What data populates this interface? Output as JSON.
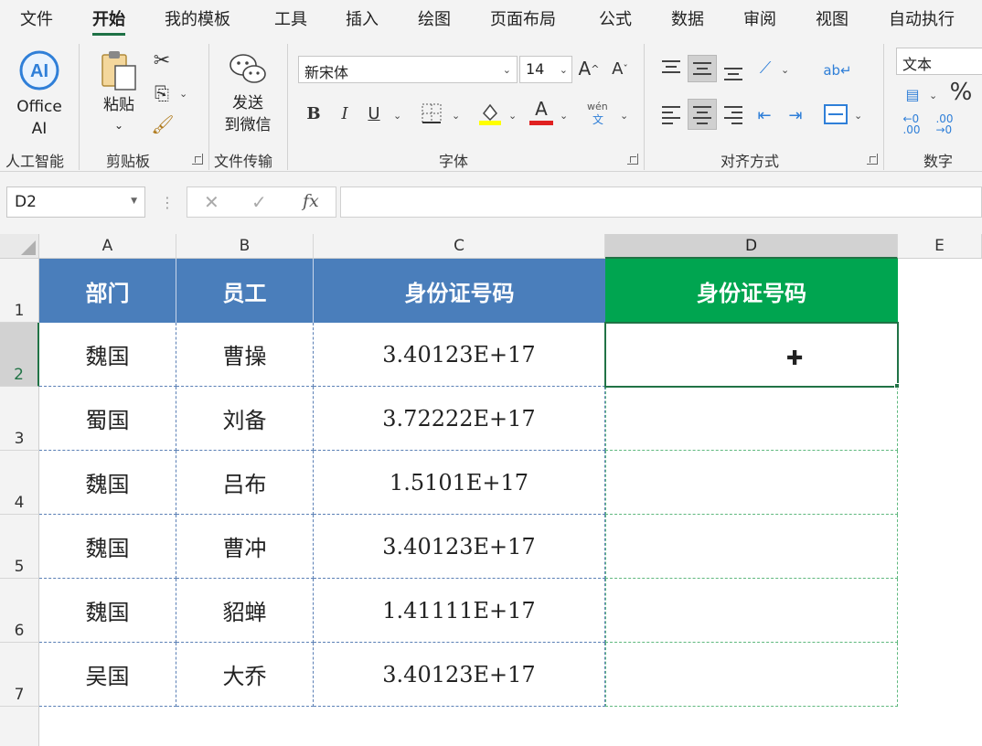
{
  "menu": {
    "tabs": [
      "文件",
      "开始",
      "我的模板",
      "工具",
      "插入",
      "绘图",
      "页面布局",
      "公式",
      "数据",
      "审阅",
      "视图",
      "自动执行"
    ],
    "active": "开始"
  },
  "ribbon": {
    "ai_group": {
      "button_line1": "Office",
      "button_line2": "AI",
      "label": "人工智能"
    },
    "clipboard": {
      "paste_label": "粘贴",
      "label": "剪贴板"
    },
    "transfer": {
      "button_line1": "发送",
      "button_line2": "到微信",
      "label": "文件传输"
    },
    "font": {
      "font_name": "新宋体",
      "font_size": "14",
      "label": "字体",
      "bold": "B",
      "italic": "I",
      "underline": "U",
      "grow": "A",
      "shrink": "A",
      "font_color_letter": "A",
      "phonetic_top": "wén",
      "phonetic_bottom": "文"
    },
    "align": {
      "label": "对齐方式"
    },
    "number": {
      "format": "文本",
      "label": "数字",
      "percent": "%"
    }
  },
  "formula_bar": {
    "name_box": "D2",
    "fx": "fx",
    "formula": ""
  },
  "sheet": {
    "columns": [
      "A",
      "B",
      "C",
      "D",
      "E"
    ],
    "rows": [
      "1",
      "2",
      "3",
      "4",
      "5",
      "6",
      "7"
    ],
    "header": [
      "部门",
      "员工",
      "身份证号码",
      "身份证号码"
    ],
    "data": [
      [
        "魏国",
        "曹操",
        "3.40123E+17",
        ""
      ],
      [
        "蜀国",
        "刘备",
        "3.72222E+17",
        ""
      ],
      [
        "魏国",
        "吕布",
        "1.5101E+17",
        ""
      ],
      [
        "魏国",
        "曹冲",
        "3.40123E+17",
        ""
      ],
      [
        "魏国",
        "貂蝉",
        "1.41111E+17",
        ""
      ],
      [
        "吴国",
        "大乔",
        "3.40123E+17",
        ""
      ]
    ],
    "selected_cell": "D2",
    "colors": {
      "header_blue": "#4a7ebb",
      "header_green": "#00a550",
      "selection": "#217346"
    }
  }
}
